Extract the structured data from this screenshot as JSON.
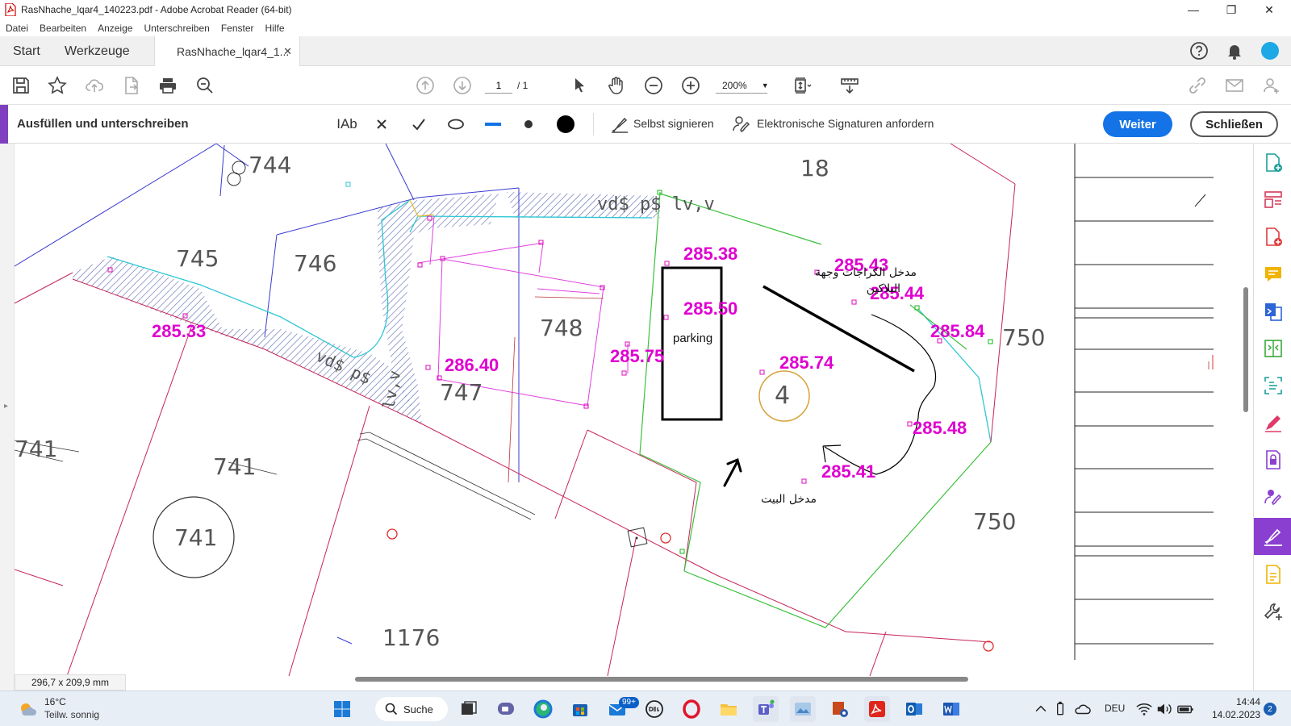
{
  "window": {
    "title": "RasNhache_lqar4_140223.pdf - Adobe Acrobat Reader (64-bit)",
    "minimize": "—",
    "restore": "❐",
    "close": "✕"
  },
  "menu": [
    "Datei",
    "Bearbeiten",
    "Anzeige",
    "Unterschreiben",
    "Fenster",
    "Hilfe"
  ],
  "tabs": {
    "start": "Start",
    "tools": "Werkzeuge",
    "document": "RasNhache_lqar4_1...",
    "document_close": "✕"
  },
  "toolbar": {
    "page_current": "1",
    "page_total": "/ 1",
    "zoom": "200%"
  },
  "fill_sign": {
    "title": "Ausfüllen und unterschreiben",
    "text_tool": "IAb",
    "self_sign": "Selbst signieren",
    "request_signatures": "Elektronische Signaturen anfordern",
    "continue_button": "Weiter",
    "close_button": "Schließen"
  },
  "document": {
    "page_size": "296,7 x 209,9 mm",
    "parcels": [
      "744",
      "745",
      "746",
      "748",
      "747",
      "741",
      "741",
      "741",
      "18",
      "750",
      "750",
      "1176",
      "4"
    ],
    "elevations": [
      "285.38",
      "285.50",
      "285.43",
      "285.44",
      "285.84",
      "285.33",
      "286.40",
      "285.75",
      "285.74",
      "285.48",
      "285.41"
    ],
    "parking_label": "parking",
    "arabic_garage_entry": "مدخل الكراجات وجهة",
    "arabic_garage_entry_2": "البلاكين",
    "arabic_house_entry": "مدخل البيت",
    "hatch_text_1": "vd$  p$  lv,v",
    "hatch_text_2": "vd$  p$",
    "hatch_text_3": "lv,v"
  },
  "taskbar": {
    "weather_temp": "16°C",
    "weather_desc": "Teilw. sonnig",
    "search": "Suche",
    "mail_badge": "99+",
    "lang": "DEU",
    "time": "14:44",
    "date": "14.02.2023",
    "notif_count": "2"
  },
  "colors": {
    "accent_purple": "#7f3fbf",
    "primary_blue": "#1473e6",
    "elevation_magenta": "#e000d0"
  }
}
